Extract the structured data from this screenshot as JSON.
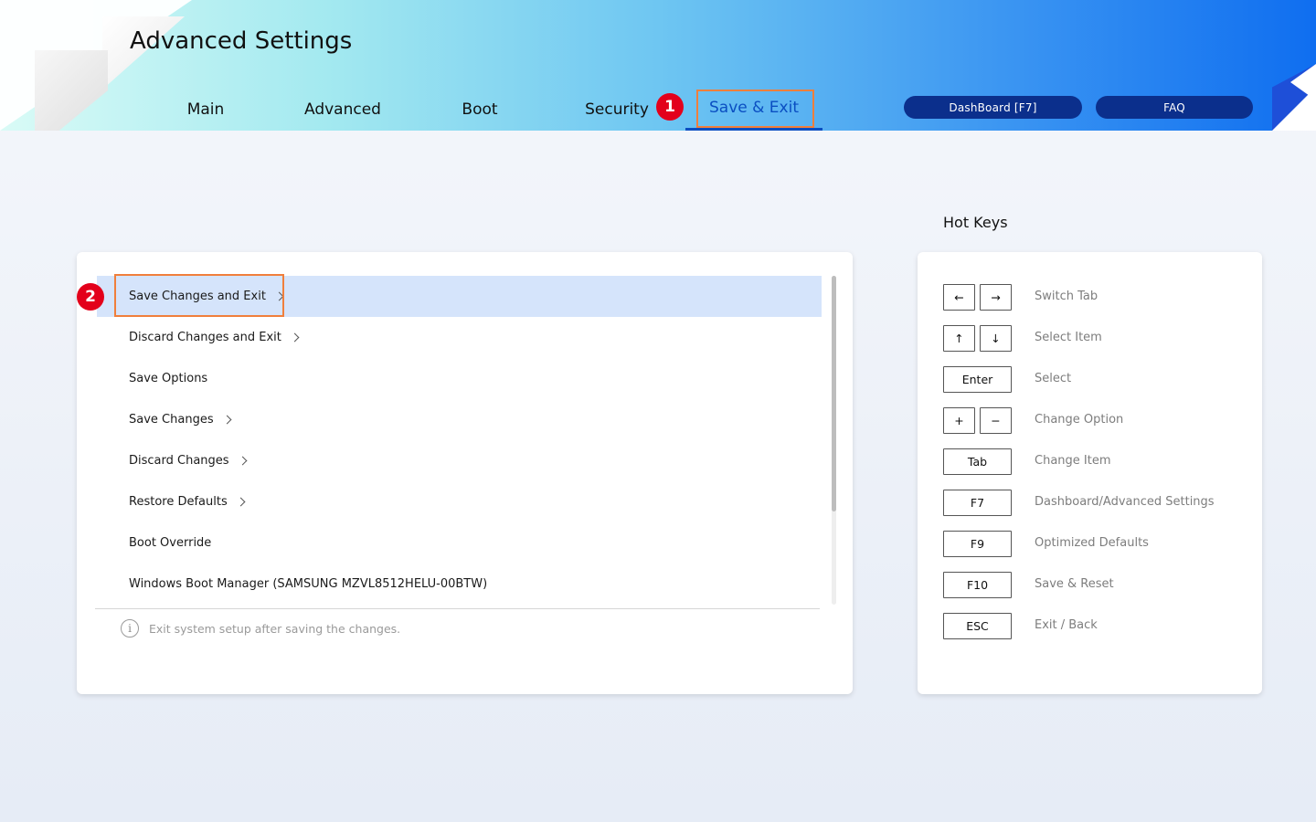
{
  "header": {
    "title": "Advanced Settings",
    "tabs": [
      {
        "label": "Main"
      },
      {
        "label": "Advanced"
      },
      {
        "label": "Boot"
      },
      {
        "label": "Security"
      },
      {
        "label": "Save & Exit"
      }
    ],
    "dashboard_button": "DashBoard [F7]",
    "faq_button": "FAQ"
  },
  "markers": {
    "m1": "1",
    "m2": "2"
  },
  "menu": {
    "items": [
      {
        "label": "Save Changes and Exit"
      },
      {
        "label": "Discard Changes and Exit"
      },
      {
        "label": "Save Options"
      },
      {
        "label": "Save Changes"
      },
      {
        "label": "Discard Changes"
      },
      {
        "label": "Restore Defaults"
      },
      {
        "label": "Boot Override"
      },
      {
        "label": "Windows Boot Manager (SAMSUNG MZVL8512HELU-00BTW)"
      }
    ],
    "help_text": "Exit system setup after saving the changes."
  },
  "hotkeys": {
    "title": "Hot Keys",
    "rows": [
      {
        "keys": [
          "←",
          "→"
        ],
        "desc": "Switch Tab"
      },
      {
        "keys": [
          "↑",
          "↓"
        ],
        "desc": "Select Item"
      },
      {
        "keys": [
          "Enter"
        ],
        "desc": "Select"
      },
      {
        "keys": [
          "+",
          "−"
        ],
        "desc": "Change Option"
      },
      {
        "keys": [
          "Tab"
        ],
        "desc": "Change Item"
      },
      {
        "keys": [
          "F7"
        ],
        "desc": "Dashboard/Advanced Settings"
      },
      {
        "keys": [
          "F9"
        ],
        "desc": "Optimized Defaults"
      },
      {
        "keys": [
          "F10"
        ],
        "desc": "Save & Reset"
      },
      {
        "keys": [
          "ESC"
        ],
        "desc": "Exit / Back"
      }
    ]
  },
  "colors": {
    "accent": "#0a4ec2",
    "highlight_box": "#f07f3c",
    "marker": "#e3001b",
    "selected_row": "#d5e4fb",
    "header_button": "#0b2f8c"
  }
}
